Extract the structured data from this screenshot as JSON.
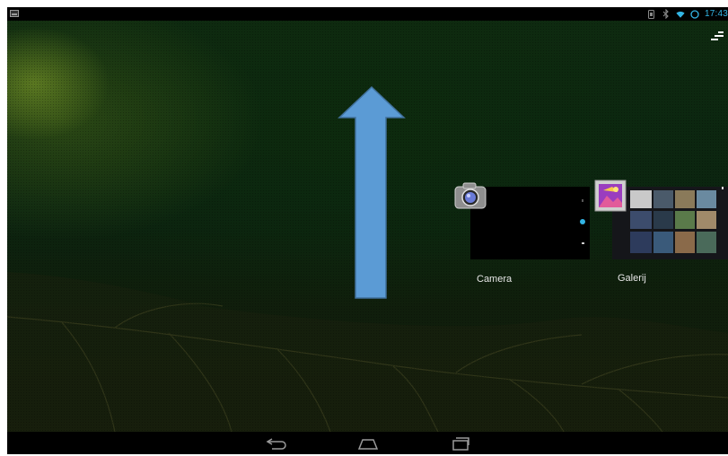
{
  "status_bar": {
    "time": "17:43",
    "icons": [
      "screenshot-icon",
      "sim-icon",
      "bluetooth-icon",
      "wifi-icon",
      "sync-icon"
    ],
    "accent_color": "#33b5e5"
  },
  "recent_apps": [
    {
      "label": "Camera",
      "icon": "camera-icon"
    },
    {
      "label": "Galerij",
      "icon": "gallery-icon"
    }
  ],
  "overlay": {
    "arrow_color": "#5b9bd5",
    "arrow_direction": "up"
  },
  "nav_bar": {
    "buttons": [
      "back-icon",
      "home-icon",
      "recent-apps-icon"
    ]
  }
}
